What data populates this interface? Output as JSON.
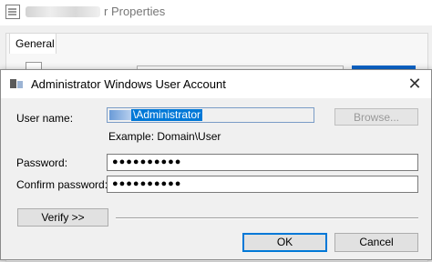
{
  "background_window": {
    "title_suffix": "r Properties",
    "tab_label": "General"
  },
  "dialog": {
    "title": "Administrator Windows User Account",
    "close_glyph": "✕",
    "user_name_label": "User name:",
    "user_name_value": "\\Administrator",
    "browse_label": "Browse...",
    "example_text": "Example: Domain\\User",
    "password_label": "Password:",
    "password_mask": "●●●●●●●●●●",
    "confirm_password_label": "Confirm password:",
    "confirm_password_mask": "●●●●●●●●●●",
    "verify_label": "Verify >>",
    "ok_label": "OK",
    "cancel_label": "Cancel"
  },
  "colors": {
    "accent": "#0078d7",
    "dialog_bg": "#f0f0f0"
  }
}
